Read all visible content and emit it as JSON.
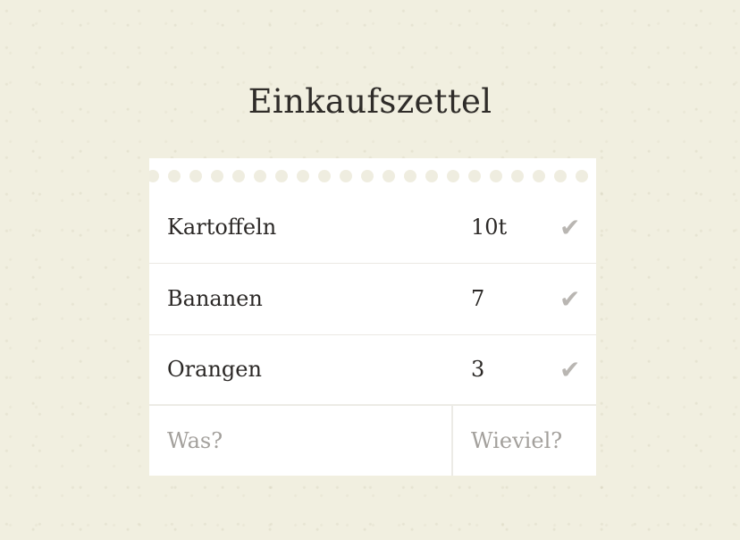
{
  "title": "Einkaufszettel",
  "items": [
    {
      "name": "Kartoffeln",
      "qty": "10t",
      "check": "✔"
    },
    {
      "name": "Bananen",
      "qty": "7",
      "check": "✔"
    },
    {
      "name": "Orangen",
      "qty": "3",
      "check": "✔"
    }
  ],
  "form": {
    "what_placeholder": "Was?",
    "what_value": "",
    "howmany_placeholder": "Wieviel?",
    "howmany_value": ""
  },
  "colors": {
    "background": "#f1efe0",
    "paper": "#ffffff",
    "text": "#2b2826",
    "check": "#b9b6b2",
    "placeholder": "#a3a09c"
  },
  "icons": {
    "check": "check-icon"
  }
}
